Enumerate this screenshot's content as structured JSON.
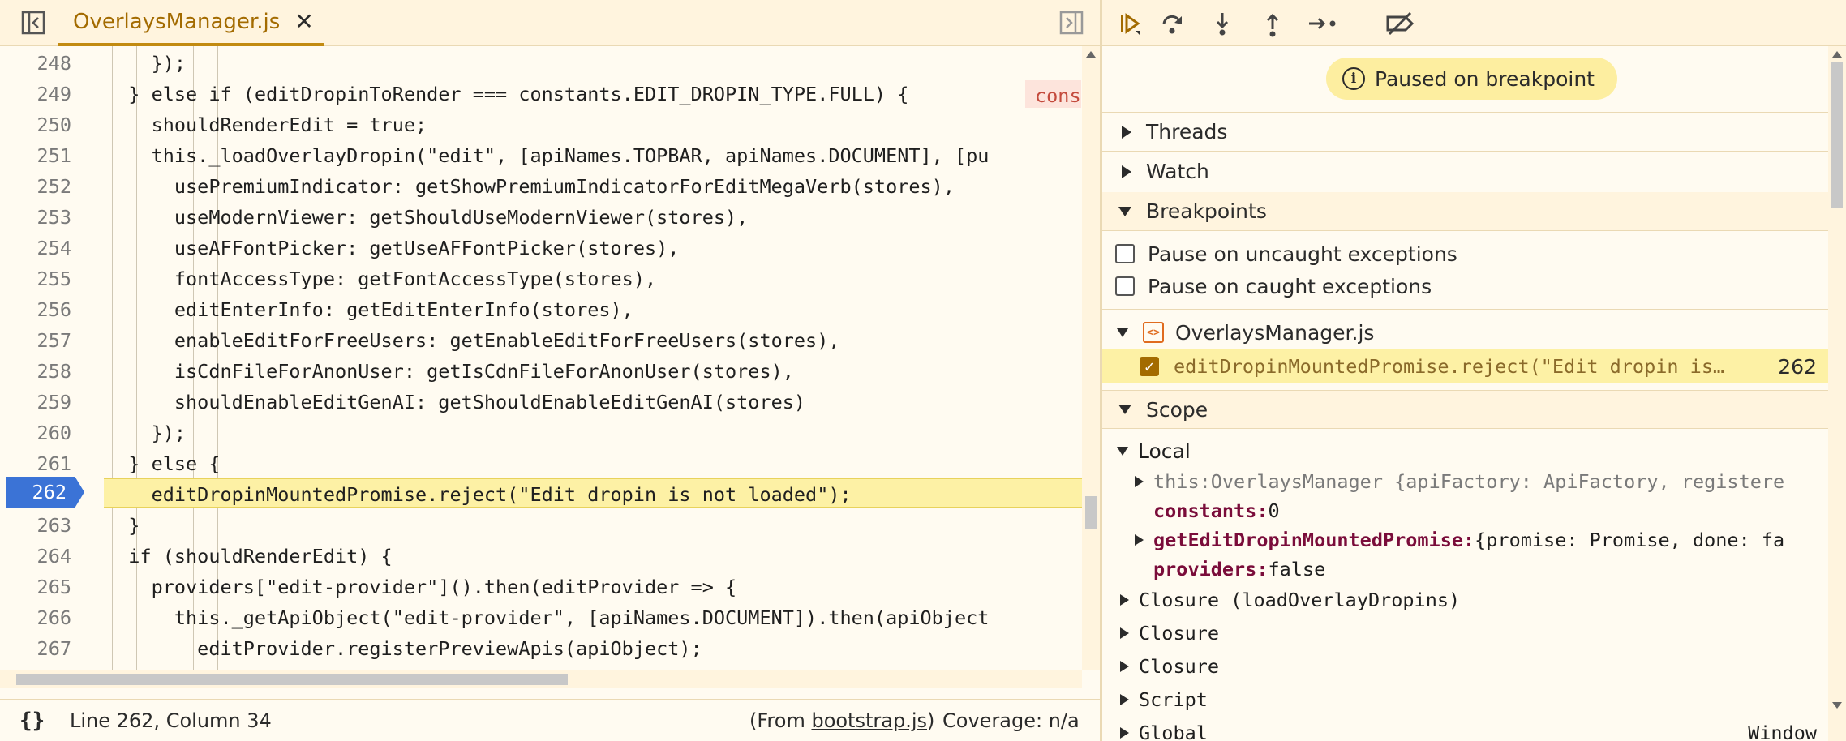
{
  "editor": {
    "tab_label": "OverlaysManager.js",
    "tab_close": "✕",
    "status": {
      "braces": "{}",
      "position": "Line 262, Column 34",
      "from_prefix": "(From ",
      "from_file": "bootstrap.js",
      "from_suffix": ")",
      "coverage": "Coverage: n/a"
    },
    "lines": [
      {
        "num": "248",
        "code": "    });"
      },
      {
        "num": "249",
        "code": "  } else if (editDropinToRender === constants.EDIT_DROPIN_TYPE.FULL) {"
      },
      {
        "num": "250",
        "code": "    shouldRenderEdit = true;"
      },
      {
        "num": "251",
        "code": "    this._loadOverlayDropin(\"edit\", [apiNames.TOPBAR, apiNames.DOCUMENT], [pu"
      },
      {
        "num": "252",
        "code": "      usePremiumIndicator: getShowPremiumIndicatorForEditMegaVerb(stores),"
      },
      {
        "num": "253",
        "code": "      useModernViewer: getShouldUseModernViewer(stores),"
      },
      {
        "num": "254",
        "code": "      useAFFontPicker: getUseAFFontPicker(stores),"
      },
      {
        "num": "255",
        "code": "      fontAccessType: getFontAccessType(stores),"
      },
      {
        "num": "256",
        "code": "      editEnterInfo: getEditEnterInfo(stores),"
      },
      {
        "num": "257",
        "code": "      enableEditForFreeUsers: getEnableEditForFreeUsers(stores),"
      },
      {
        "num": "258",
        "code": "      isCdnFileForAnonUser: getIsCdnFileForAnonUser(stores),"
      },
      {
        "num": "259",
        "code": "      shouldEnableEditGenAI: getShouldEnableEditGenAI(stores)"
      },
      {
        "num": "260",
        "code": "    });"
      },
      {
        "num": "261",
        "code": "  } else {"
      },
      {
        "num": "262",
        "code": "    editDropinMountedPromise.reject(\"Edit dropin is not loaded\");"
      },
      {
        "num": "263",
        "code": "  }"
      },
      {
        "num": "264",
        "code": "  if (shouldRenderEdit) {"
      },
      {
        "num": "265",
        "code": "    providers[\"edit-provider\"]().then(editProvider => {"
      },
      {
        "num": "266",
        "code": "      this._getApiObject(\"edit-provider\", [apiNames.DOCUMENT]).then(apiObject"
      },
      {
        "num": "267",
        "code": "        editProvider.registerPreviewApis(apiObject);"
      }
    ],
    "inline_hint": "cons",
    "current_line": "262"
  },
  "debugger": {
    "paused_label": "Paused on breakpoint",
    "sections": {
      "threads": "Threads",
      "watch": "Watch",
      "breakpoints": "Breakpoints",
      "scope": "Scope"
    },
    "pause_uncaught": "Pause on uncaught exceptions",
    "pause_caught": "Pause on caught exceptions",
    "bp_file": "OverlaysManager.js",
    "bp_text": "editDropinMountedPromise.reject(\"Edit dropin is…",
    "bp_line": "262",
    "scope": {
      "local": "Local",
      "this_key": "this:",
      "this_val": " OverlaysManager {apiFactory: ApiFactory, registere",
      "constants_key": "constants:",
      "constants_val": " 0",
      "getEdit_key": "getEditDropinMountedPromise:",
      "getEdit_val": " {promise: Promise, done: fa",
      "providers_key": "providers:",
      "providers_val": " false",
      "closure1": "Closure (loadOverlayDropins)",
      "closure2": "Closure",
      "closure3": "Closure",
      "script": "Script",
      "global": "Global",
      "global_val": "Window"
    }
  },
  "colors": {
    "accent": "#a36b00",
    "breakpoint_marker": "#3b73d6",
    "current_line_bg": "#fdf1a5",
    "panel_bg": "#fffbf1"
  }
}
